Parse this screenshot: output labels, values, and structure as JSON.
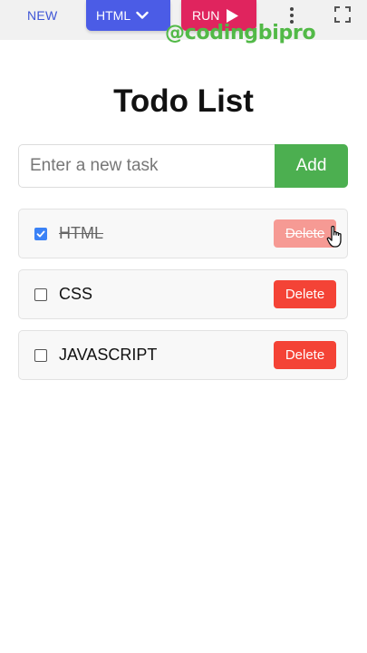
{
  "toolbar": {
    "new_label": "NEW",
    "html_label": "HTML",
    "run_label": "RUN"
  },
  "watermark": "@codingbipro",
  "app": {
    "title": "Todo List",
    "input_placeholder": "Enter a new task",
    "add_label": "Add",
    "tasks": [
      {
        "text": "HTML",
        "done": true,
        "delete_label": "Delete"
      },
      {
        "text": "CSS",
        "done": false,
        "delete_label": "Delete"
      },
      {
        "text": "JAVASCRIPT",
        "done": false,
        "delete_label": "Delete"
      }
    ]
  },
  "colors": {
    "html_tab": "#4b5ce6",
    "run_button": "#e0245e",
    "add_button": "#4caf50",
    "delete_button": "#f44336",
    "watermark": "#52b947"
  }
}
